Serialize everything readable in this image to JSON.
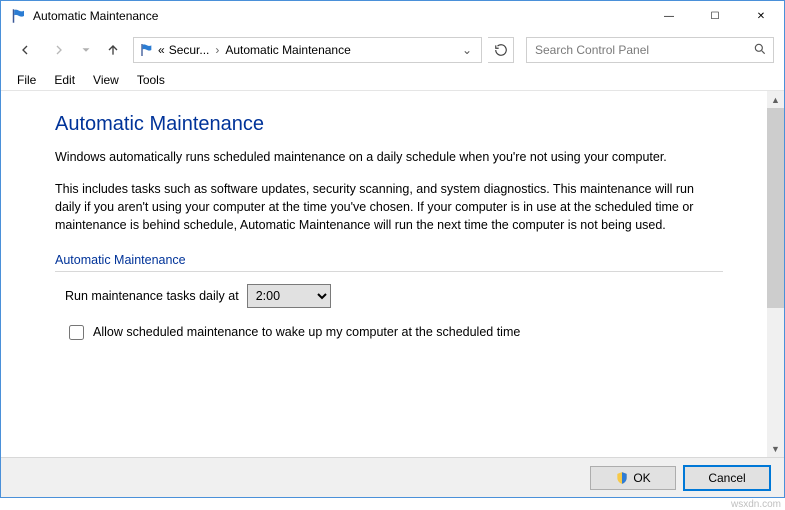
{
  "titlebar": {
    "title": "Automatic Maintenance"
  },
  "nav": {
    "breadcrumb": {
      "ellipsis": "«",
      "part1": "Secur...",
      "part2": "Automatic Maintenance"
    },
    "search_placeholder": "Search Control Panel"
  },
  "menu": {
    "file": "File",
    "edit": "Edit",
    "view": "View",
    "tools": "Tools"
  },
  "page": {
    "title": "Automatic Maintenance",
    "p1": "Windows automatically runs scheduled maintenance on a daily schedule when you're not using your computer.",
    "p2": "This includes tasks such as software updates, security scanning, and system diagnostics. This maintenance will run daily if you aren't using your computer at the time you've chosen. If your computer is in use at the scheduled time or maintenance is behind schedule, Automatic Maintenance will run the next time the computer is not being used.",
    "section": "Automatic Maintenance",
    "run_label": "Run maintenance tasks daily at",
    "time_value": "2:00",
    "allow_wake": "Allow scheduled maintenance to wake up my computer at the scheduled time"
  },
  "footer": {
    "ok": "OK",
    "cancel": "Cancel"
  },
  "watermark": "wsxdn.com"
}
